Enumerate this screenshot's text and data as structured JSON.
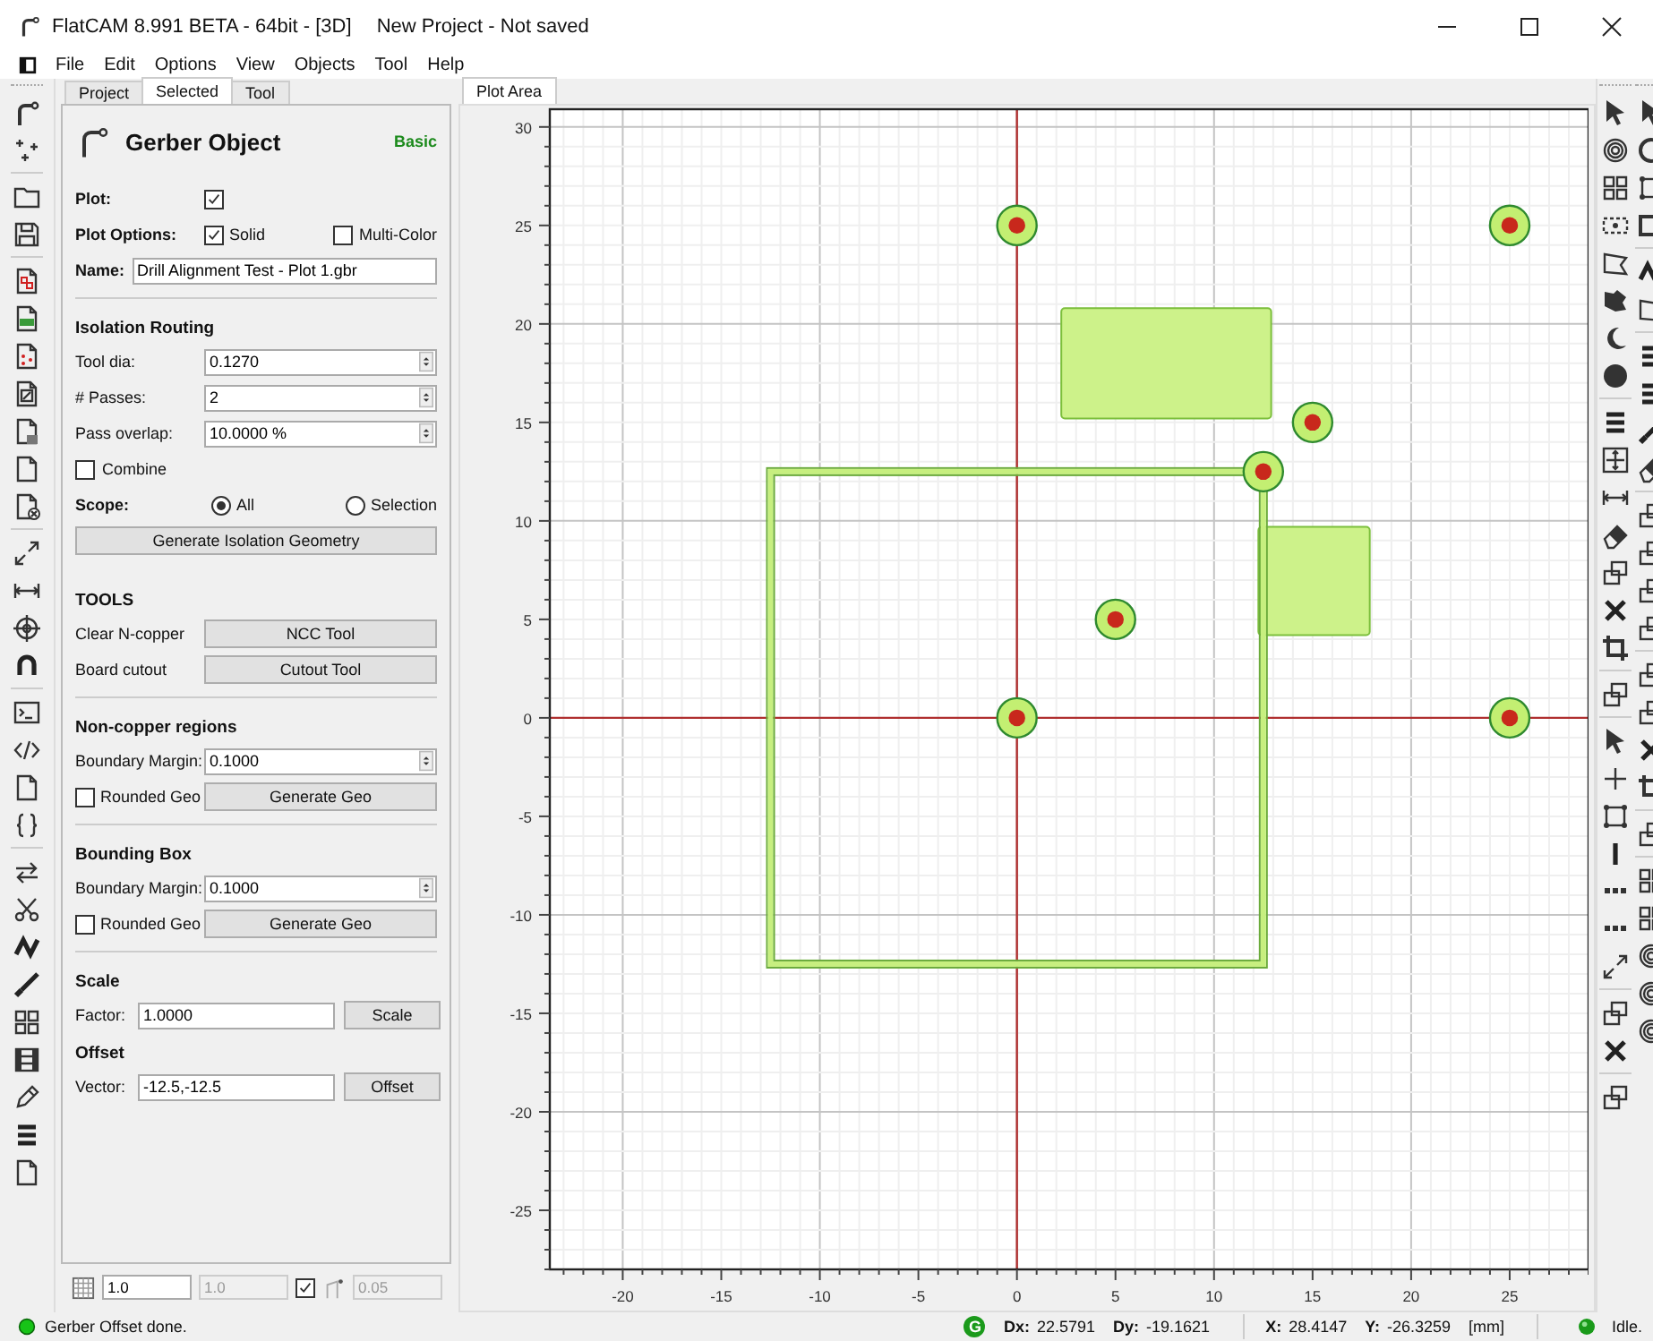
{
  "window": {
    "title": "FlatCAM 8.991 BETA - 64bit - [3D]",
    "subtitle": "New Project - Not saved"
  },
  "menu": [
    "File",
    "Edit",
    "Options",
    "View",
    "Objects",
    "Tool",
    "Help"
  ],
  "notebook_tabs": [
    {
      "label": "Project",
      "selected": false
    },
    {
      "label": "Selected",
      "selected": true
    },
    {
      "label": "Tool",
      "selected": false
    }
  ],
  "object_panel": {
    "title": "Gerber Object",
    "mode": "Basic",
    "rows": [
      {
        "kind": "checks",
        "label": "Plot:",
        "options": [
          {
            "checked": true
          }
        ]
      },
      {
        "kind": "checks",
        "label": "Plot Options:",
        "options": [
          {
            "label": "Solid",
            "checked": true
          },
          {
            "label": "Multi-Color",
            "checked": false
          }
        ]
      },
      {
        "kind": "name-field",
        "label": "Name:",
        "value": "Drill Alignment Test - Plot 1.gbr"
      },
      {
        "kind": "separator"
      },
      {
        "kind": "heading",
        "text": "Isolation Routing"
      },
      {
        "kind": "spin-field",
        "label": "Tool dia:",
        "value": "0.1270"
      },
      {
        "kind": "spin-field",
        "label": "# Passes:",
        "value": "2"
      },
      {
        "kind": "spin-field",
        "label": "Pass overlap:",
        "value": "10.0000 %"
      },
      {
        "kind": "check",
        "label": "Combine",
        "checked": false
      },
      {
        "kind": "radio",
        "label": "Scope:",
        "options": [
          {
            "label": "All",
            "selected": true
          },
          {
            "label": "Selection",
            "selected": false
          }
        ]
      },
      {
        "kind": "button",
        "label": "Generate Isolation Geometry"
      },
      {
        "kind": "spacer"
      },
      {
        "kind": "heading",
        "text": "TOOLS"
      },
      {
        "kind": "labeled-button",
        "label": "Clear N-copper",
        "button": "NCC Tool"
      },
      {
        "kind": "labeled-button",
        "label": "Board cutout",
        "button": "Cutout Tool"
      },
      {
        "kind": "separator"
      },
      {
        "kind": "heading",
        "text": "Non-copper regions"
      },
      {
        "kind": "spin-field",
        "label": "Boundary Margin:",
        "value": "0.1000"
      },
      {
        "kind": "check-button",
        "label": "Rounded Geo",
        "checked": false,
        "button": "Generate Geo"
      },
      {
        "kind": "separator"
      },
      {
        "kind": "heading",
        "text": "Bounding Box"
      },
      {
        "kind": "spin-field",
        "label": "Boundary Margin:",
        "value": "0.1000"
      },
      {
        "kind": "check-button",
        "label": "Rounded Geo",
        "checked": false,
        "button": "Generate Geo"
      },
      {
        "kind": "separator"
      },
      {
        "kind": "heading",
        "text": "Scale"
      },
      {
        "kind": "field-button",
        "label": "Factor:",
        "value": "1.0000",
        "button": "Scale"
      },
      {
        "kind": "heading",
        "text": "Offset"
      },
      {
        "kind": "field-button",
        "label": "Vector:",
        "value": "-12.5,-12.5",
        "button": "Offset"
      }
    ]
  },
  "snap_bar": {
    "grid_x": {
      "value": "1.0",
      "disabled": false
    },
    "grid_y": {
      "value": "1.0",
      "disabled": true
    },
    "grid_lock": {
      "checked": true
    },
    "snap_max": {
      "value": "0.05",
      "disabled": true
    }
  },
  "plot": {
    "tab": {
      "label": "Plot Area",
      "selected": true
    },
    "shapes": [
      {
        "kind": "filled-rect"
      },
      {
        "kind": "filled-rect"
      },
      {
        "kind": "outline-rect"
      }
    ],
    "chart_data": {
      "type": "scatter",
      "grid": true,
      "xlim": [
        -23.7,
        29
      ],
      "ylim": [
        -28,
        30.9
      ],
      "xticks": [
        -20,
        -15,
        -10,
        -5,
        0,
        5,
        10,
        15,
        20,
        25
      ],
      "yticks": [
        -25,
        -20,
        -15,
        -10,
        -5,
        0,
        5,
        10,
        15,
        20,
        25,
        30
      ],
      "x": [
        0,
        25,
        15,
        12.5,
        5,
        0,
        25
      ],
      "series": [
        {
          "color": "#c3ef72",
          "values": [
            25,
            25,
            15,
            12.5,
            5,
            0,
            0
          ]
        }
      ]
    }
  },
  "status_bar": {
    "message": "Gerber Offset done.",
    "grid_badge": "G",
    "deltas": [
      {
        "label": "Dx:",
        "value": "22.5791"
      },
      {
        "label": "Dy:",
        "value": "-19.1621"
      }
    ],
    "position": [
      {
        "label": "X:",
        "value": "28.4147"
      },
      {
        "label": "Y:",
        "value": "-26.3259"
      }
    ],
    "units": "[mm]",
    "state": "Idle."
  }
}
